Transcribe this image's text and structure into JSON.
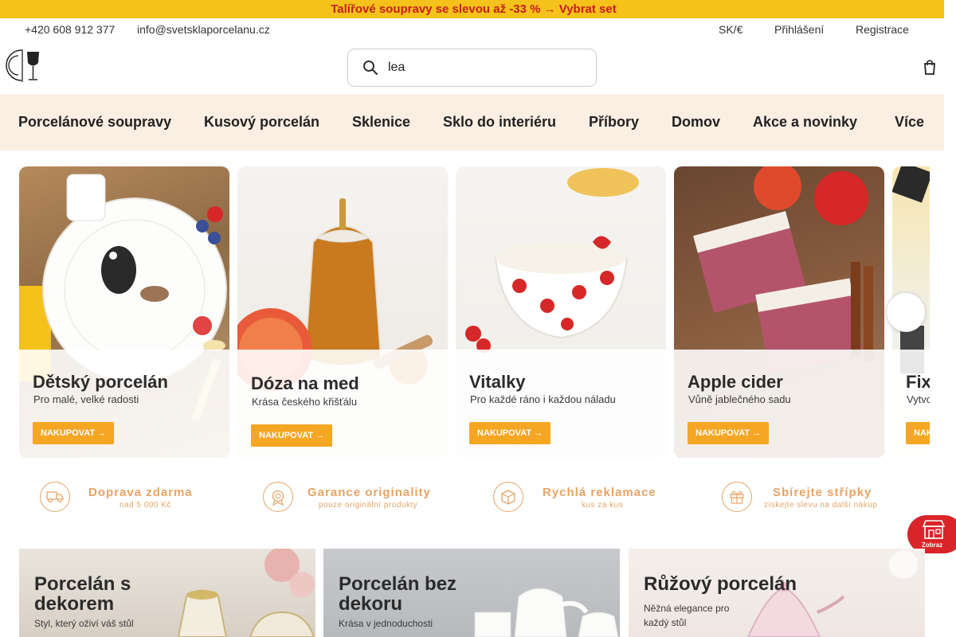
{
  "promo": {
    "icon": "tag-icon",
    "glyph": "",
    "text": "Talířové soupravy se slevou až -33 % → Vybrat set"
  },
  "contact": {
    "phone_glyph": "",
    "phone": "+420 608 912 377",
    "email_glyph": "",
    "email": "info@svetsklaporcelanu.cz"
  },
  "top_right": {
    "currency": "SK/€",
    "login": "Přihlášení",
    "register": "Registrace"
  },
  "search": {
    "value": "lea",
    "icon_glyph": ""
  },
  "nav": {
    "items": [
      "Porcelánové soupravy",
      "Kusový porcelán",
      "Sklenice",
      "Sklo do interiéru",
      "Příbory",
      "Domov",
      "Akce a novinky",
      "Více"
    ],
    "sale_glyph": "",
    "more_glyph": ""
  },
  "slides": [
    {
      "title": "Dětský porcelán",
      "subtitle": "Pro malé, velké radosti",
      "button": "NAKUPOVAT →"
    },
    {
      "title": "Dóza na med",
      "subtitle": "Krása českého křišťálu",
      "button": "NAKUPOVAT →"
    },
    {
      "title": "Vitalky",
      "subtitle": "Pro každé ráno i každou náladu",
      "button": "NAKUPOVAT →"
    },
    {
      "title": "Apple cider",
      "subtitle": "Vůně jablečného sadu",
      "button": "NAKUPOVAT →"
    },
    {
      "title": "Fix",
      "subtitle": "Vytvo",
      "button": "NAK"
    }
  ],
  "carousel_next_glyph": "",
  "features": [
    {
      "title": "Doprava zdarma",
      "subtitle": "nad 5 000 Kč",
      "icon": "truck-icon"
    },
    {
      "title": "Garance originality",
      "subtitle": "pouze originální produkty",
      "icon": "badge-icon"
    },
    {
      "title": "Rychlá reklamace",
      "subtitle": "kus za kus",
      "icon": "box-icon"
    },
    {
      "title": "Sbírejte střípky",
      "subtitle": "získejte slevu na další nákup",
      "icon": "gift-icon"
    }
  ],
  "store_badge": {
    "label": "Zobraz"
  },
  "categories": [
    {
      "title_line1": "Porcelán s",
      "title_line2": "dekorem",
      "subtitle": "Styl, který oživí váš stůl"
    },
    {
      "title_line1": "Porcelán bez",
      "title_line2": "dekoru",
      "subtitle": "Krása v jednoduchosti"
    },
    {
      "title_line1": "Růžový porcelán",
      "title_line2": "",
      "subtitle_line1": "Něžná elegance pro",
      "subtitle_line2": "každý stůl"
    }
  ],
  "colors": {
    "promo_bg": "#f4c21a",
    "promo_text": "#c81e1e",
    "nav_bg": "#fbeee3",
    "accent": "#e6a466",
    "button": "#f5a623",
    "badge": "#d9252a"
  }
}
